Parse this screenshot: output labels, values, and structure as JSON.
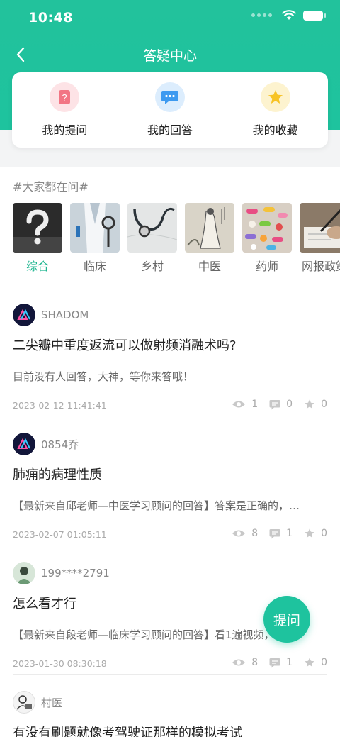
{
  "status_bar": {
    "time": "10:48"
  },
  "nav": {
    "title": "答疑中心",
    "back_icon": "chevron-left-icon"
  },
  "quick_actions": [
    {
      "label": "我的提问",
      "icon": "question-doc-icon",
      "color": "#f06b7a"
    },
    {
      "label": "我的回答",
      "icon": "chat-bubble-icon",
      "color": "#3d9af0"
    },
    {
      "label": "我的收藏",
      "icon": "star-icon",
      "color": "#f7c325"
    }
  ],
  "section_title": "#大家都在问#",
  "categories": [
    {
      "label": "综合",
      "active": true,
      "image": "question-mark-photo"
    },
    {
      "label": "临床",
      "active": false,
      "image": "doctor-coat-photo"
    },
    {
      "label": "乡村",
      "active": false,
      "image": "stethoscope-photo"
    },
    {
      "label": "中医",
      "active": false,
      "image": "chinese-painting-photo"
    },
    {
      "label": "药师",
      "active": false,
      "image": "pills-photo"
    },
    {
      "label": "网报政策",
      "active": false,
      "image": "writing-photo"
    }
  ],
  "posts": [
    {
      "username": "SHADOM",
      "title": "二尖瓣中重度返流可以做射频消融术吗?",
      "excerpt": "目前没有人回答，大神，等你来答哦！",
      "date": "2023-02-12 11:41:41",
      "views": "1",
      "comments": "0",
      "favorites": "0"
    },
    {
      "username": "0854乔",
      "title": "肺痈的病理性质",
      "excerpt": "【最新来自邱老师—中医学习顾问的回答】答案是正确的，…",
      "date": "2023-02-07 01:05:11",
      "views": "8",
      "comments": "1",
      "favorites": "0"
    },
    {
      "username": "199****2791",
      "title": "怎么看才行",
      "excerpt": "【最新来自段老师—临床学习顾问的回答】看1遍视频，做2…",
      "date": "2023-01-30 08:30:18",
      "views": "8",
      "comments": "1",
      "favorites": "0"
    },
    {
      "username": "村医",
      "title": "有没有刷题就像考驾驶证那样的模拟考试"
    }
  ],
  "fab": {
    "label": "提问"
  },
  "colors": {
    "primary": "#1ec39e",
    "active_tab": "#1eb690"
  }
}
